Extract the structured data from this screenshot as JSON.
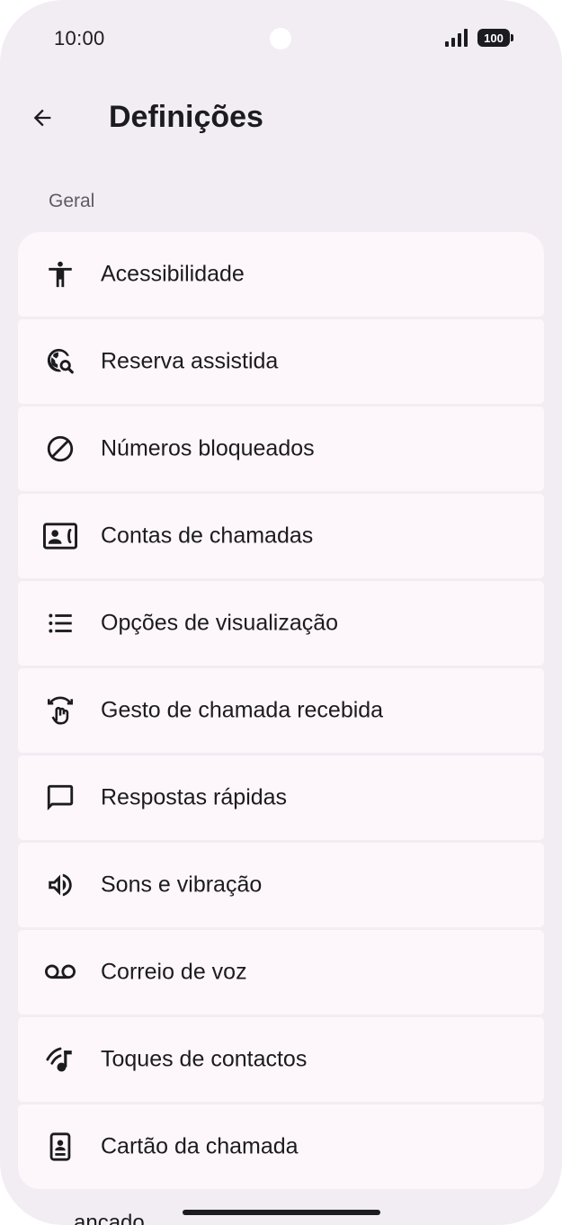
{
  "status_bar": {
    "time": "10:00",
    "battery": "100",
    "signal_icon": "signal-icon",
    "battery_icon": "battery-icon"
  },
  "app_bar": {
    "back_icon": "arrow-back-icon",
    "title": "Definições"
  },
  "section": {
    "header": "Geral"
  },
  "items": [
    {
      "label": "Acessibilidade",
      "icon": "accessibility-icon"
    },
    {
      "label": "Reserva assistida",
      "icon": "travel-explore-icon"
    },
    {
      "label": "Números bloqueados",
      "icon": "block-icon"
    },
    {
      "label": "Contas de chamadas",
      "icon": "contact-phone-icon"
    },
    {
      "label": "Opções de visualização",
      "icon": "list-icon"
    },
    {
      "label": "Gesto de chamada recebida",
      "icon": "swipe-gesture-icon"
    },
    {
      "label": "Respostas rápidas",
      "icon": "chat-bubble-icon"
    },
    {
      "label": "Sons e vibração",
      "icon": "volume-icon"
    },
    {
      "label": "Correio de voz",
      "icon": "voicemail-icon"
    },
    {
      "label": "Toques de contactos",
      "icon": "ringtone-icon"
    },
    {
      "label": "Cartão da chamada",
      "icon": "call-card-icon"
    }
  ],
  "peek_text": "ancado",
  "colors": {
    "background": "#f2ecf3",
    "card": "#fdf7fc",
    "text": "#1c1b1f",
    "secondary_text": "#5f5a66"
  }
}
